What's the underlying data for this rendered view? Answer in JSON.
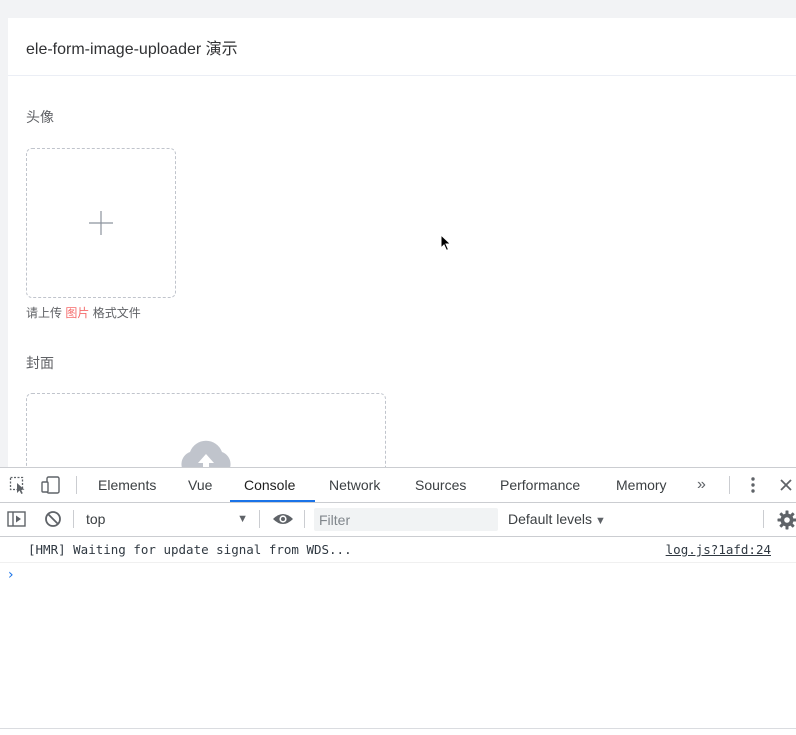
{
  "page": {
    "title": "ele-form-image-uploader 演示",
    "avatar_label": "头像",
    "tip_prefix": "请上传",
    "tip_highlight": "图片",
    "tip_suffix": "格式文件",
    "cover_label": "封面"
  },
  "devtools": {
    "tabs": [
      "Elements",
      "Vue",
      "Console",
      "Network",
      "Sources",
      "Performance",
      "Memory"
    ],
    "active_tab": "Console",
    "more_tabs": "»",
    "context": "top",
    "filter_placeholder": "Filter",
    "levels": "Default levels",
    "log": {
      "message": "[HMR] Waiting for update signal from WDS...",
      "source": "log.js?1afd:24"
    },
    "prompt": "›"
  },
  "colors": {
    "accent": "#1a73e8",
    "highlight": "#f56c6c",
    "icon_gray": "#c0c4cc"
  }
}
